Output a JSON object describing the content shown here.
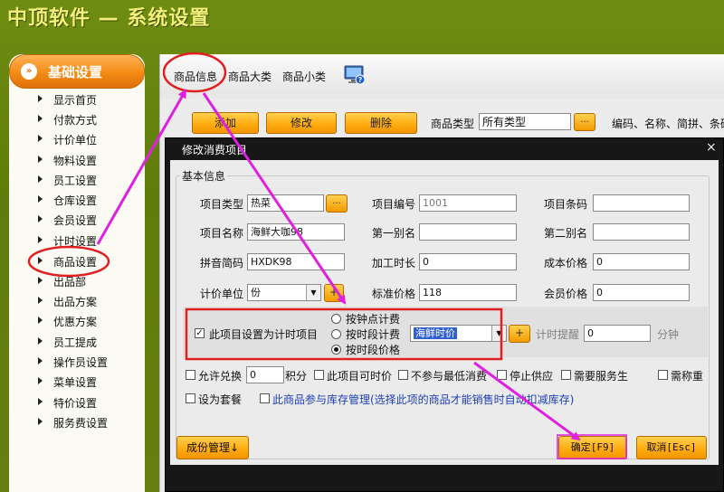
{
  "app": {
    "title": "中顶软件 — 系统设置"
  },
  "sidebar": {
    "header": "基础设置",
    "items": [
      {
        "label": "显示首页"
      },
      {
        "label": "付款方式"
      },
      {
        "label": "计价单位"
      },
      {
        "label": "物料设置"
      },
      {
        "label": "员工设置"
      },
      {
        "label": "仓库设置"
      },
      {
        "label": "会员设置"
      },
      {
        "label": "计时设置"
      },
      {
        "label": "商品设置"
      },
      {
        "label": "出品部"
      },
      {
        "label": "出品方案"
      },
      {
        "label": "优惠方案"
      },
      {
        "label": "员工提成"
      },
      {
        "label": "操作员设置"
      },
      {
        "label": "菜单设置"
      },
      {
        "label": "特价设置"
      },
      {
        "label": "服务费设置"
      }
    ]
  },
  "tabs": [
    {
      "label": "商品信息"
    },
    {
      "label": "商品大类"
    },
    {
      "label": "商品小类"
    }
  ],
  "toolbar": {
    "add": "添加",
    "edit": "修改",
    "delete": "删除",
    "type_label": "商品类型",
    "type_value": "所有类型",
    "dots": "...",
    "search_hint": "编码、名称、简拼、条码"
  },
  "dialog": {
    "title": "修改消费项目",
    "close": "×",
    "group": "基本信息",
    "fields": {
      "item_type_label": "项目类型",
      "item_type_value": "热菜",
      "item_code_label": "项目编号",
      "item_code_value": "1001",
      "barcode_label": "项目条码",
      "barcode_value": "",
      "name_label": "项目名称",
      "name_value": "海鲜大咖98",
      "alias1_label": "第一别名",
      "alias1_value": "",
      "alias2_label": "第二别名",
      "alias2_value": "",
      "pinyin_label": "拼音简码",
      "pinyin_value": "HXDK98",
      "process_label": "加工时长",
      "process_value": "0",
      "cost_label": "成本价格",
      "cost_value": "0",
      "unit_label": "计价单位",
      "unit_value": "份",
      "std_price_label": "标准价格",
      "std_price_value": "118",
      "member_price_label": "会员价格",
      "member_price_value": "0"
    },
    "timing": {
      "enable_label": "此项目设置为计时项目",
      "radio_by_clock": "按钟点计费",
      "radio_by_period": "按时段计费",
      "radio_by_period_price": "按时段价格",
      "period_select": "海鲜时价",
      "plus": "+",
      "reminder_label": "计时提醒",
      "reminder_value": "0",
      "minutes_label": "分钟"
    },
    "options": {
      "allow_exchange": "允许兑换",
      "exchange_value": "0",
      "points": "积分",
      "allow_time_price": "此项目可时价",
      "no_min_consume": "不参与最低消费",
      "stop_supply": "停止供应",
      "need_waiter": "需要服务生",
      "need_weigh": "需称重",
      "set_combo": "设为套餐",
      "inventory": "此商品参与库存管理(选择此项的商品才能销售时自动扣减库存)"
    },
    "buttons": {
      "composition": "成份管理↓",
      "ok": "确定[F9]",
      "cancel": "取消[Esc]"
    }
  },
  "colors": {
    "background": "#6d8a10",
    "accent_orange": "#f39a00",
    "annotation": "#e020e0",
    "highlight_red": "#e02020"
  },
  "icons": {
    "monitor": "monitor-help-icon",
    "nav_bullet": "double-arrow-icon",
    "nav_item": "triangle-right-icon"
  }
}
